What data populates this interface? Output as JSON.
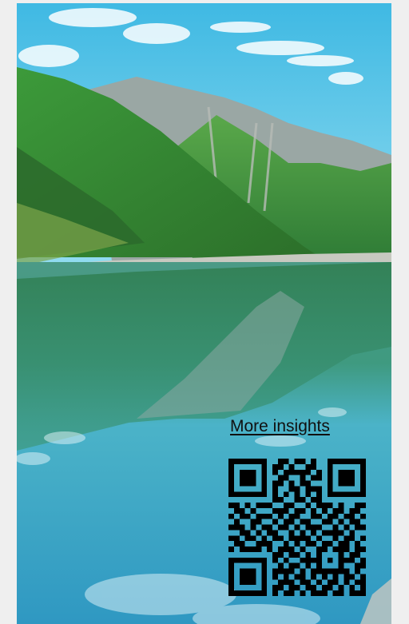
{
  "scene": {
    "description_icon": "mountain-lake-landscape"
  },
  "promo": {
    "link_text": "More insights"
  },
  "qr_code": {
    "icon": "qr-code-icon",
    "modules": [
      "1111111001101101001111111",
      "1000001011010011001000001",
      "1011101010111110101011101",
      "1011101001100101101011101",
      "1011101011010110001011101",
      "1000001010011011101000001",
      "1111111010101010101111111",
      "0000000011001101100000000",
      "1101011100110010111010011",
      "0110100011101101010110110",
      "1011011101011001101101101",
      "0100110010110110011010110",
      "1110101101101011100101011",
      "0011010110010101011110100",
      "1101101011011110100101101",
      "0110011100101011011011010",
      "1011110101110100110111011",
      "0000000011011010100010110",
      "1111111010100111101011101",
      "1000001001011010100010011",
      "1011101011110101111111010",
      "1011101010101101010101101",
      "1011101001110110101101011",
      "1000001011011011011010101",
      "1111111010110101110110111"
    ]
  },
  "colors": {
    "sky_top": "#3fbfe6",
    "sky_bottom": "#8fdcf2",
    "mountain_green": "#3f9a3a",
    "rock": "#9aa3a0",
    "lake": "#3aa6c8",
    "text": "#111111"
  }
}
